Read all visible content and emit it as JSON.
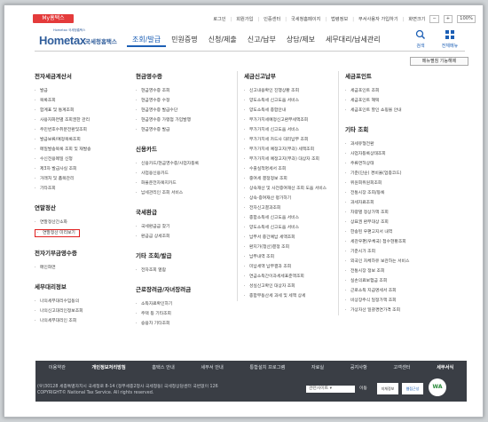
{
  "header": {
    "myhome": "My홈택스",
    "util": [
      "로그인",
      "회원가입",
      "인증센터",
      "국세청홈페이지",
      "법령정보",
      "부서사용자 가입하기",
      "화면크기"
    ],
    "zoom": "100%",
    "logo_main": "Hometax",
    "logo_side": "국세청홈택스",
    "logo_sub": "Hometax 국세청홈택스",
    "menu": [
      "조회/발급",
      "민원증명",
      "신청/제출",
      "신고/납부",
      "상담/제보",
      "세무대리/납세관리"
    ],
    "search": "검색",
    "allmenu": "전체메뉴",
    "map_button": "메뉴펼침 기능해제"
  },
  "col1": {
    "h1": "전자세금계산서",
    "i1": [
      "발급",
      "목록조회",
      "합계표 및 통계조회",
      "사용자화면별 조회권한 관리",
      "주민번호수취분전환및조회",
      "발급보류/예정목록조회",
      "메일발송목록 조회 및 재발송",
      "수신전용메일 신청",
      "제3자 발급사실 조회",
      "거래처 및 품목관리",
      "기타조회"
    ],
    "h2": "연말정산",
    "i2": [
      "연말정산간소화",
      "연말정산 미리보기"
    ],
    "h3": "전자기부금영수증",
    "i3": [
      "메인화면"
    ],
    "h4": "세무대리정보",
    "i4": [
      "나의세무대리수임동의",
      "나의신고대리인정보조회",
      "나의세무대리인 조회"
    ]
  },
  "col2": {
    "h1": "현금영수증",
    "i1": [
      "현금영수증 조회",
      "현금영수증 수정",
      "현금영수증 발급수단",
      "현금영수증 가맹점 가입발행",
      "현금영수증 발급"
    ],
    "h2": "신용카드",
    "i2": [
      "신용카드/현금영수증/사업자등록",
      "사업용신용카드",
      "화물운전자복지카드",
      "납세관리인 조회 서비스"
    ],
    "h3": "국세환급",
    "i3": [
      "국세환급금 찾기",
      "환급금 상세조회"
    ],
    "h4": "기타 조회/발급",
    "i4": [
      "전자조회 열람"
    ],
    "h5": "근로장려금/자녀장려금",
    "i5": [
      "소득자료확인하기",
      "주택 등 기타조회",
      "승용차 기타조회"
    ]
  },
  "col3": {
    "h1": "세금신고납부",
    "i1": [
      "신고내용확인 진행상황 조회",
      "양도소득세 신고도움 서비스",
      "양도소득세 종합안내",
      "부가가치세예정신고환부세액조회",
      "부가가치세 신고도움 서비스",
      "부가가치세 카드사 대리납부 조회",
      "부가가치세 예정고지(부과) 세액조회",
      "부가가치세 예정고지(부과) 대상자 조회",
      "수출실적명세서 조회",
      "중여세 결정정보 조회",
      "상속재산 및 사전증여재산 조회 도움 서비스",
      "상속·증여재산 평가하기",
      "전자신고결과조회",
      "종합소득세 신고도움 서비스",
      "양도소득세 신고도움 서비스",
      "납부서 중간예납 세액조회",
      "환지가(청산)결정 조회",
      "납부내역 조회",
      "미납세액 납부결과 조회",
      "연금소득간이과세세표준액조회",
      "성실신고확인 대상자 조회",
      "종합부동산세 과세 및 세액 상세"
    ]
  },
  "col4": {
    "h1": "세금포인트",
    "i1": [
      "세금포인트 조회",
      "세금포인트 혜택",
      "세금포인트 할인 쇼핑몰 안내"
    ],
    "h2": "기타 조회",
    "i2": [
      "과세유형전환",
      "사업자등록상태조회",
      "주류면허상태",
      "기준(단순) 경비율(업종코드)",
      "위원회위원회조회",
      "전통시장 조회/등록",
      "과세자료조회",
      "차량별 정상가액 조회",
      "상표권 환부대상 조회",
      "한송된 우편고지서 내역",
      "세관우편(우체국) 접수현황조회",
      "기준시가 조회",
      "외국인 자체하유 보관하는 서비스",
      "전통시장 정보 조회",
      "실손의료보험금 조회",
      "근로소득 지급명세서 조회",
      "비상장주식 일정가액 조회",
      "가상자산 일괄경연가격 조회"
    ]
  },
  "footer": {
    "links": [
      "이용약관",
      "개인정보처리방침",
      "홈택스 안내",
      "세무서 안내",
      "통합설치 프로그램",
      "자료실",
      "공지사항",
      "고객센터",
      "세무서식"
    ],
    "address": "(우)30128 세종특별자치시 국세청로 8-14 (정부세종2청사 국세청동) 국세청상담센터 국번없이 126",
    "copyright": "COPYRIGHT© National Tax Service. All rights reserved.",
    "related": "관련사이트",
    "go": "이동",
    "badge1": "지체정보",
    "badge2": "웹접근성",
    "badge3": "WA"
  }
}
